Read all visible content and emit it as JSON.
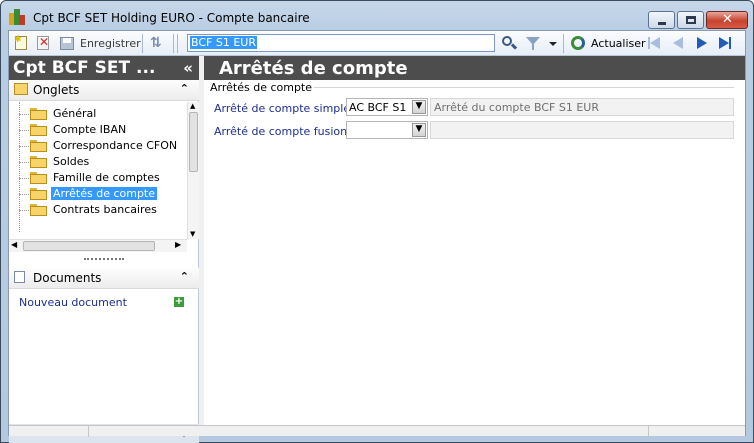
{
  "window": {
    "title": "Cpt BCF SET Holding EURO -  Compte bancaire",
    "controls": [
      "minimize",
      "maximize",
      "close"
    ]
  },
  "toolbar": {
    "save_label": "Enregistrer",
    "search_value": "BCF S1 EUR",
    "refresh_label": "Actualiser",
    "icons": [
      "new-icon",
      "delete-icon",
      "save-icon",
      "sync-icon",
      "search-icon",
      "filter-icon",
      "dropdown-icon",
      "refresh-icon",
      "first-icon",
      "previous-icon",
      "next-icon",
      "last-icon"
    ]
  },
  "left_pane": {
    "title": "Cpt BCF SET ...",
    "collapse_glyph": "«",
    "tabs_section": {
      "label": "Onglets",
      "items": [
        {
          "label": "Général"
        },
        {
          "label": "Compte IBAN"
        },
        {
          "label": "Correspondance CFON"
        },
        {
          "label": "Soldes"
        },
        {
          "label": "Famille de comptes"
        },
        {
          "label": "Arrêtés de compte",
          "selected": true
        },
        {
          "label": "Contrats bancaires"
        }
      ]
    },
    "documents_section": {
      "label": "Documents",
      "new_document": "Nouveau document"
    }
  },
  "right_pane": {
    "title": "Arrêtés de compte",
    "group_label": "Arrêtés de compte",
    "fields": [
      {
        "label": "Arrêté de compte simple",
        "value": "AC BCF S1",
        "description": "Arrêté du compte BCF S1 EUR"
      },
      {
        "label": "Arrêté de compte fusionné",
        "value": "",
        "description": ""
      }
    ]
  },
  "colors": {
    "header_bg": "#4d4d4d",
    "selection": "#3399ff",
    "label_blue": "#1c2f8f"
  }
}
